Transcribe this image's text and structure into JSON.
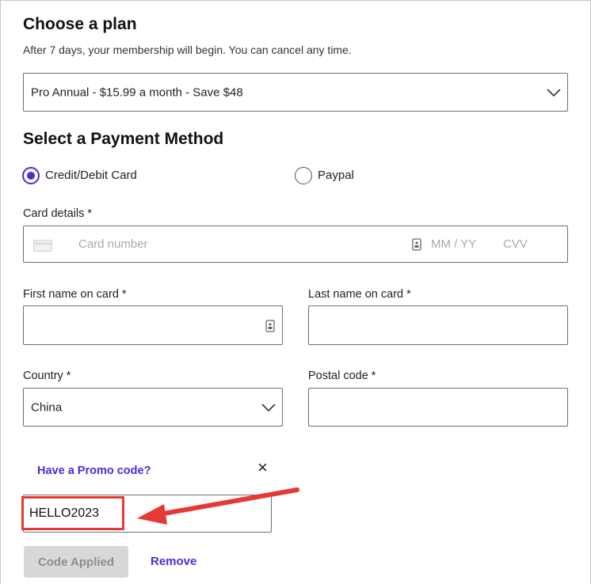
{
  "plan": {
    "title": "Choose a plan",
    "subtitle": "After 7 days, your membership will begin. You can cancel any time.",
    "selected_option": "Pro Annual - $15.99 a month - Save $48"
  },
  "payment": {
    "title": "Select a Payment Method",
    "option_card": "Credit/Debit Card",
    "option_paypal": "Paypal",
    "selected": "Credit/Debit Card"
  },
  "card": {
    "label": "Card details *",
    "number_placeholder": "Card number",
    "expiry_placeholder": "MM / YY",
    "cvv_placeholder": "CVV"
  },
  "name": {
    "first_label": "First name on card *",
    "first_value": "",
    "last_label": "Last name on card *",
    "last_value": ""
  },
  "address": {
    "country_label": "Country *",
    "country_value": "China",
    "postal_label": "Postal code *",
    "postal_value": ""
  },
  "promo": {
    "toggle_label": "Have a Promo code?",
    "close_glyph": "×",
    "code_value": "HELLO2023",
    "applied_button": "Code Applied",
    "remove_link": "Remove"
  },
  "colors": {
    "accent": "#4b2bd6",
    "annotation": "#e53935"
  }
}
